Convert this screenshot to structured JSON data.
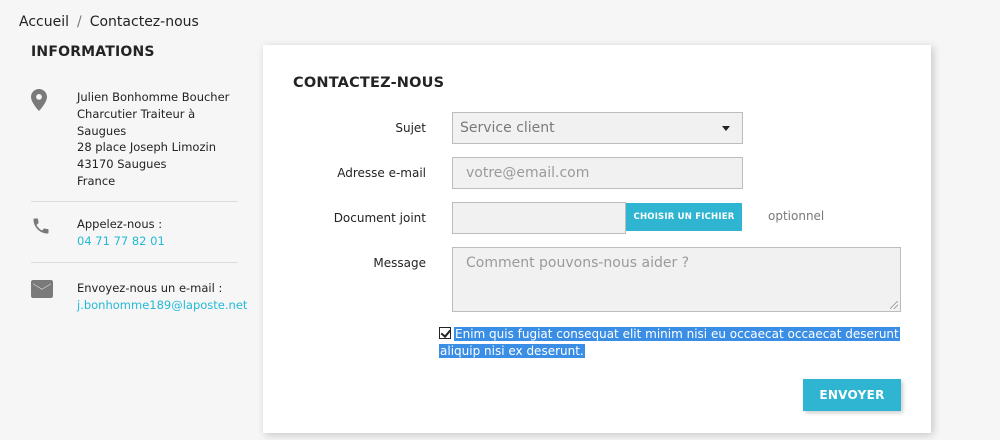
{
  "breadcrumb": {
    "home": "Accueil",
    "separator": "/",
    "current": "Contactez-nous"
  },
  "info": {
    "title": "INFORMATIONS",
    "address": {
      "icon": "location-pin-icon",
      "lines": [
        "Julien Bonhomme Boucher",
        "Charcutier Traiteur à",
        "Saugues",
        "28 place Joseph Limozin",
        "43170 Saugues",
        "France"
      ]
    },
    "phone": {
      "icon": "phone-icon",
      "label": "Appelez-nous :",
      "value": "04 71 77 82 01"
    },
    "email": {
      "icon": "mail-icon",
      "label": "Envoyez-nous un e-mail :",
      "value": "j.bonhomme189@laposte.net"
    }
  },
  "form": {
    "title": "CONTACTEZ-NOUS",
    "subject_label": "Sujet",
    "subject_value": "Service client",
    "email_label": "Adresse e-mail",
    "email_placeholder": "votre@email.com",
    "attachment_label": "Document joint",
    "choose_file_label": "CHOISIR UN FICHIER",
    "optional_label": "optionnel",
    "message_label": "Message",
    "message_placeholder": "Comment pouvons-nous aider ?",
    "consent_text": "Enim quis fugiat consequat elit minim nisi eu occaecat occaecat deserunt aliquip nisi ex deserunt.",
    "consent_checked": true,
    "submit_label": "ENVOYER"
  },
  "colors": {
    "accent": "#2fb5d2",
    "link": "#24b9d7",
    "selection": "#3a8ee6"
  }
}
